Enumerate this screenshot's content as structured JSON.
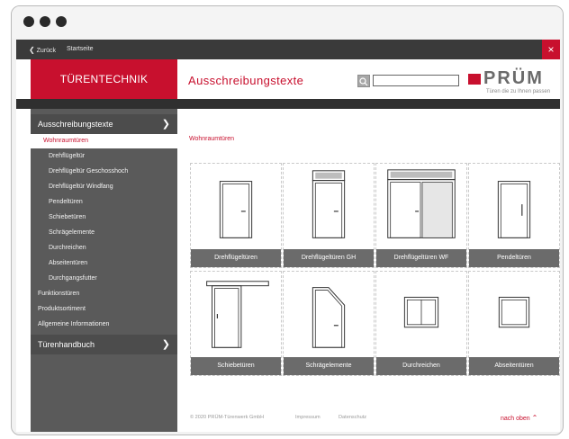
{
  "topbar": {
    "back": "Zurück",
    "home": "Startseite",
    "close": "×"
  },
  "brand": "TÜRENTECHNIK",
  "header_title": "Ausschreibungstexte",
  "search": {
    "placeholder": ""
  },
  "logo": {
    "text": "PRÜM",
    "tagline": "Türen die zu Ihnen passen"
  },
  "sidebar": {
    "section1": "Ausschreibungstexte",
    "active": "Wohnraumtüren",
    "children": [
      "Drehflügeltür",
      "Drehflügeltür Geschosshoch",
      "Drehflügeltür Windfang",
      "Pendeltüren",
      "Schiebetüren",
      "Schrägelemente",
      "Durchreichen",
      "Abseitentüren",
      "Durchgangsfutter"
    ],
    "sections": [
      "Funktionstüren",
      "Produktsortiment",
      "Allgemeine Informationen"
    ],
    "section2": "Türenhandbuch"
  },
  "main": {
    "subtitle": "Wohnraumtüren",
    "cards": [
      "Drehflügeltüren",
      "Drehflügeltüren GH",
      "Drehflügeltüren WF",
      "Pendeltüren",
      "Schiebetüren",
      "Schrägelemente",
      "Durchreichen",
      "Abseitentüren"
    ]
  },
  "footer": {
    "copyright": "© 2020 PRÜM-Türenwerk GmbH",
    "impressum": "Impressum",
    "datenschutz": "Datenschutz",
    "top": "nach oben"
  },
  "colors": {
    "accent": "#c8102e",
    "sidebar": "#5a5a5a",
    "dark": "#3a3a3a"
  }
}
